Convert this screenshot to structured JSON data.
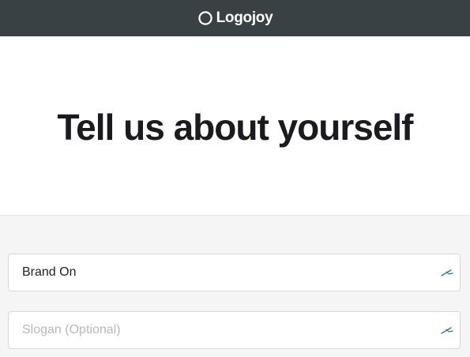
{
  "header": {
    "brand": "Logojoy",
    "bg_color": "#3a4145"
  },
  "hero": {
    "title": "Tell us about yourself"
  },
  "form": {
    "company_name": {
      "value": "Brand On",
      "placeholder": "",
      "icon": "pen-nib-icon"
    },
    "slogan": {
      "value": "",
      "placeholder": "Slogan (Optional)",
      "icon": "pen-nib-icon"
    }
  },
  "colors": {
    "title_text": "#1b1b1f",
    "field_icon": "#2a7f8f",
    "placeholder": "#b9b9b9"
  }
}
